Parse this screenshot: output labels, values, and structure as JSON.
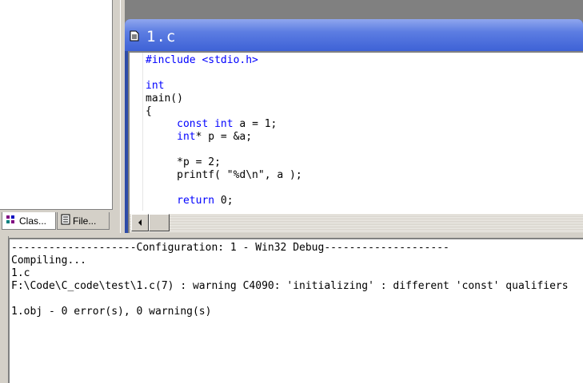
{
  "workspace": {
    "tabs": [
      {
        "label": "Clas...",
        "icon": "class-view-icon"
      },
      {
        "label": "File...",
        "icon": "file-view-icon"
      }
    ]
  },
  "editor": {
    "title": "1.c",
    "lines": [
      "#include <stdio.h>",
      "",
      "int",
      "main()",
      "{",
      "     const int a = 1;",
      "     int* p = &a;",
      "",
      "     *p = 2;",
      "     printf( \"%d\\n\", a );",
      "",
      "     return 0;"
    ],
    "colors": {
      "keyword": "#0000ff",
      "titlebar": "#3e62d6"
    }
  },
  "output": {
    "lines": [
      "--------------------Configuration: 1 - Win32 Debug--------------------",
      "Compiling...",
      "1.c",
      "F:\\Code\\C_code\\test\\1.c(7) : warning C4090: 'initializing' : different 'const' qualifiers",
      "",
      "1.obj - 0 error(s), 0 warning(s)"
    ]
  }
}
